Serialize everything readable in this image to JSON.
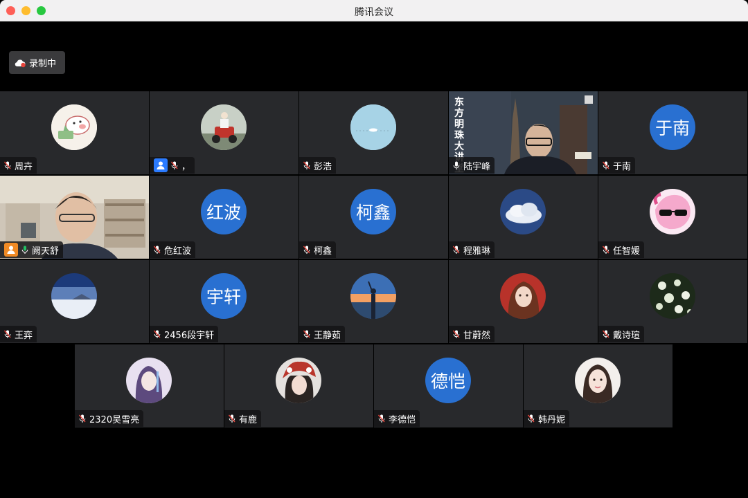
{
  "window": {
    "title": "腾讯会议"
  },
  "recording": {
    "label": "录制中"
  },
  "participants": [
    {
      "name": "周卉",
      "avatar_text": ""
    },
    {
      "name": "，",
      "avatar_text": ""
    },
    {
      "name": "彭浩",
      "avatar_text": ""
    },
    {
      "name": "陆宇峰",
      "avatar_text": "",
      "video_caption": "东方明珠大讲堂"
    },
    {
      "name": "于南",
      "avatar_text": "于南"
    },
    {
      "name": "阙天舒",
      "avatar_text": ""
    },
    {
      "name": "危红波",
      "avatar_text": "红波"
    },
    {
      "name": "柯鑫",
      "avatar_text": "柯鑫"
    },
    {
      "name": "程雅琳",
      "avatar_text": ""
    },
    {
      "name": "任智媛",
      "avatar_text": ""
    },
    {
      "name": "王弈",
      "avatar_text": ""
    },
    {
      "name": "2456段宇轩",
      "avatar_text": "宇轩"
    },
    {
      "name": "王静茹",
      "avatar_text": ""
    },
    {
      "name": "甘蔚然",
      "avatar_text": ""
    },
    {
      "name": "戴诗瑄",
      "avatar_text": ""
    },
    {
      "name": "2320吴雪亮",
      "avatar_text": ""
    },
    {
      "name": "有鹿",
      "avatar_text": ""
    },
    {
      "name": "李德恺",
      "avatar_text": "德恺"
    },
    {
      "name": "韩丹妮",
      "avatar_text": ""
    }
  ],
  "colors": {
    "avatar_blue": "#2970d1",
    "active_border": "#23c063",
    "tile_bg": "#28292c",
    "mic_muted": "#e7453c"
  }
}
